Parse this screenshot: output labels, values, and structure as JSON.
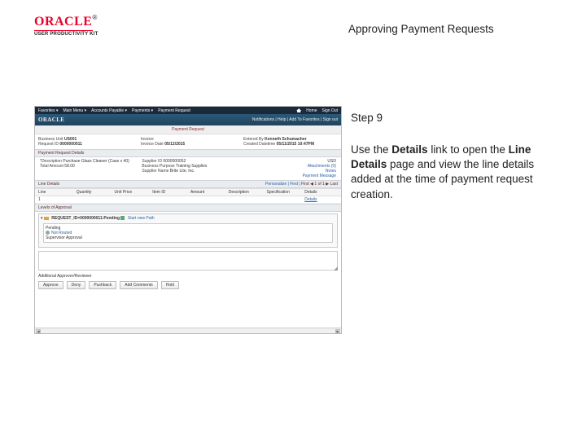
{
  "header": {
    "logo": {
      "brand": "ORACLE",
      "reg": "®",
      "kit": "USER PRODUCTIVITY KIT"
    },
    "title": "Approving Payment Requests"
  },
  "step": {
    "label": "Step 9"
  },
  "instruction": {
    "p1a": "Use the ",
    "b1": "Details",
    "p1b": " link to open the ",
    "b2": "Line Details",
    "p1c": " page and view the line details added at the time of payment request creation."
  },
  "shot": {
    "menu": [
      "Favorites ▾",
      "Main Menu ▾",
      "Accounts Payable ▾",
      "Payments ▾",
      "Payment Request"
    ],
    "topright": {
      "home": "Home",
      "signout": "Sign Out"
    },
    "logo": "ORACLE",
    "subnavRight": "Notifications | Help | Add To Favorites | Sign out",
    "pageTitle": "Payment Request",
    "info": {
      "col1": {
        "a_lbl": "Business Unit",
        "a_val": "US001",
        "b_lbl": "Request ID",
        "b_val": "0000000011"
      },
      "col2": {
        "a_lbl": "Invoice",
        "a_val": "",
        "b_lbl": "Invoice Date",
        "b_val": "05/12/2015"
      },
      "col3": {
        "a_lbl": "Entered By",
        "a_val": "Kenneth Schumacher",
        "b_lbl": "Created Datetime",
        "b_val": "05/11/2015 10:47PM"
      }
    },
    "section1": "Payment Request Details",
    "block1": {
      "col1": {
        "a_lbl": "*Description",
        "a_val": "Purchase Glass Cleaner (Case x 40)",
        "b_lbl": "Total Amount",
        "b_val": "58.00"
      },
      "col2": {
        "a_lbl": "Supplier ID",
        "a_val": "0000000052",
        "b_lbl": "Business Purpose",
        "b_val": "Training Supplies",
        "c_lbl": "Supplier Name",
        "c_val": "Brite Lite, Inc."
      },
      "col3": {
        "a_val": "USD",
        "attach": "Attachments (0)",
        "notes": "Notes",
        "msg": "Payment Message"
      }
    },
    "lineDetailsTitle": "Line Details",
    "pager": {
      "pers": "Personalize | Find |",
      "nav": "First ◀ 1 of 1 ▶ Last"
    },
    "thead": [
      "Line",
      "Quantity",
      "Unit Price",
      "Item ID",
      "Amount",
      "Description",
      "Specification",
      "Details"
    ],
    "trow": [
      "1",
      "",
      "",
      "",
      "",
      "",
      "",
      "Details"
    ],
    "approval": {
      "title": "Levels of Approval",
      "req": "REQUEST_ID=0000000011:Pending",
      "startPath": "Start new Path",
      "inner": {
        "line1": "Pending",
        "line2": "Not Routed",
        "line3": "Supervisor Approval"
      }
    },
    "commentLbl": "Additional Approver/Reviewer",
    "buttons": [
      "Approve",
      "Deny",
      "Pushback",
      "Add Comments",
      "Hold"
    ]
  }
}
